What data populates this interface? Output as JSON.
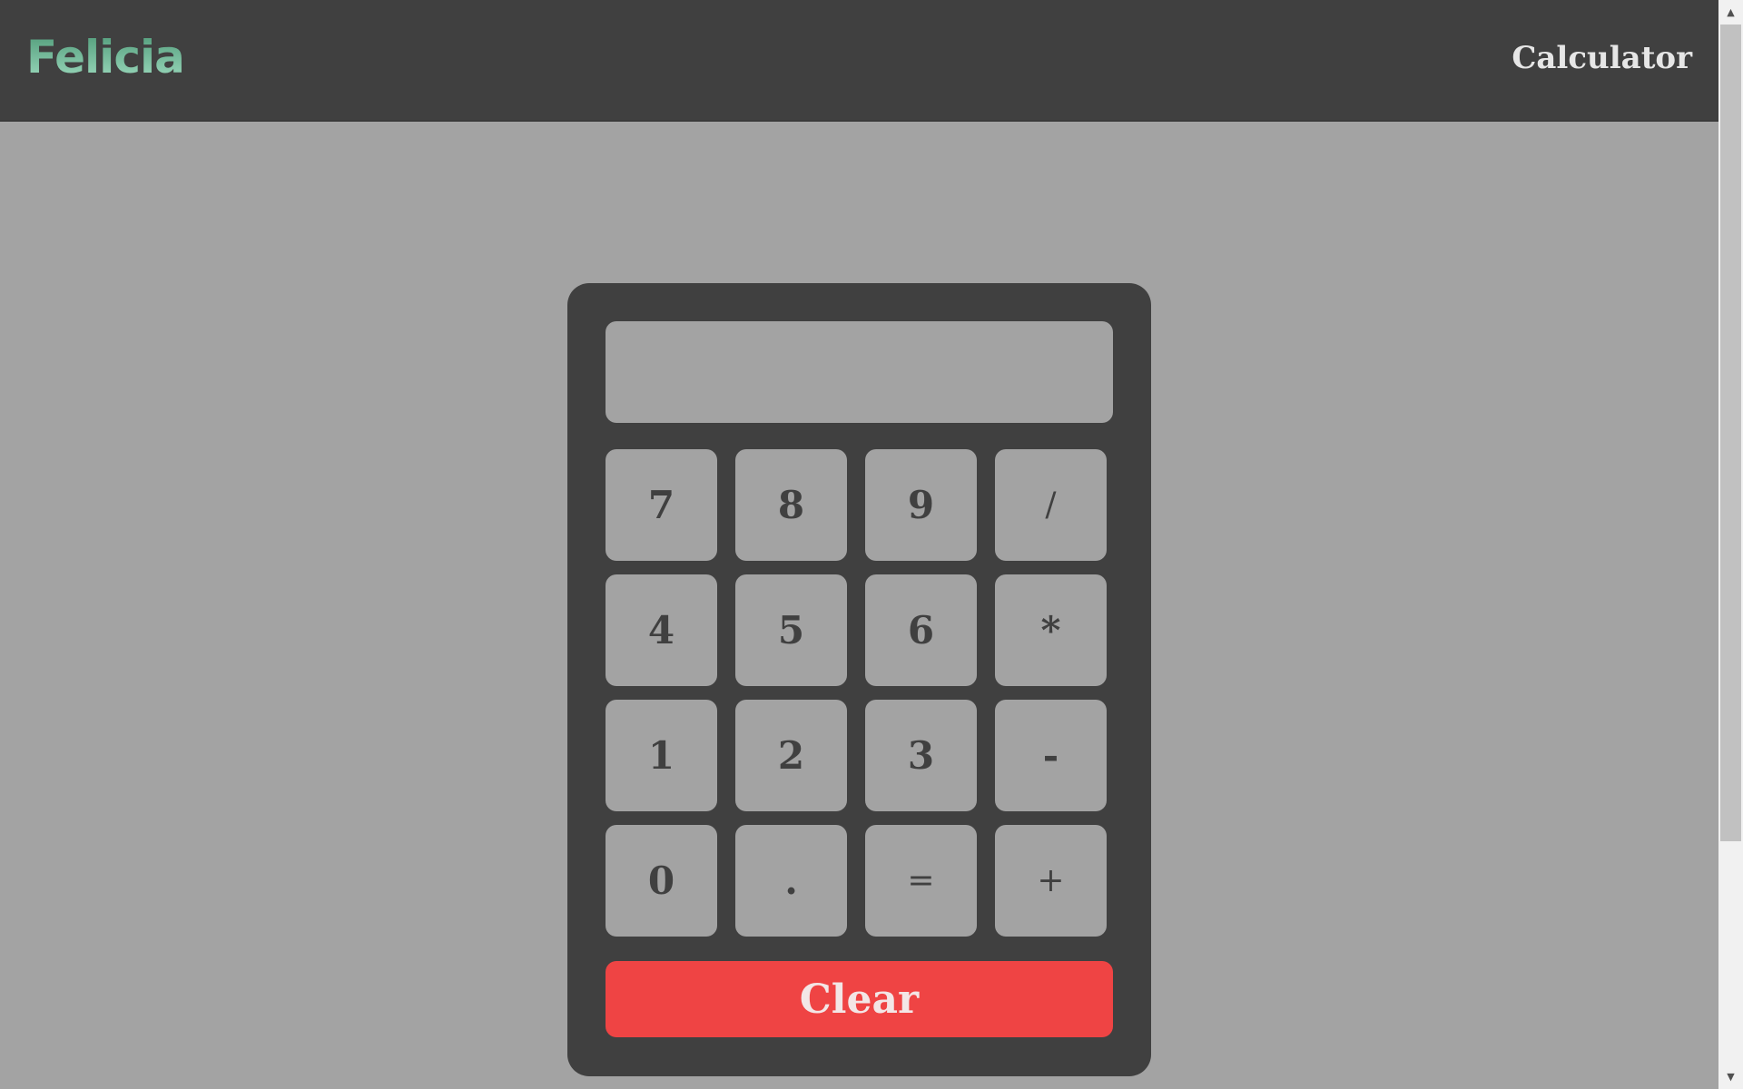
{
  "header": {
    "brand": "Felicia",
    "nav_link": "Calculator"
  },
  "calculator": {
    "display_value": "",
    "keys": [
      {
        "label": "7",
        "name": "key-7",
        "style": "bold"
      },
      {
        "label": "8",
        "name": "key-8",
        "style": "bold"
      },
      {
        "label": "9",
        "name": "key-9",
        "style": "bold"
      },
      {
        "label": "/",
        "name": "key-divide",
        "style": "light"
      },
      {
        "label": "4",
        "name": "key-4",
        "style": "bold"
      },
      {
        "label": "5",
        "name": "key-5",
        "style": "bold"
      },
      {
        "label": "6",
        "name": "key-6",
        "style": "bold"
      },
      {
        "label": "*",
        "name": "key-multiply",
        "style": "bold"
      },
      {
        "label": "1",
        "name": "key-1",
        "style": "bold"
      },
      {
        "label": "2",
        "name": "key-2",
        "style": "bold"
      },
      {
        "label": "3",
        "name": "key-3",
        "style": "bold"
      },
      {
        "label": "-",
        "name": "key-subtract",
        "style": "bold"
      },
      {
        "label": "0",
        "name": "key-0",
        "style": "bold"
      },
      {
        "label": ".",
        "name": "key-decimal",
        "style": "bold"
      },
      {
        "label": "=",
        "name": "key-equals",
        "style": "light"
      },
      {
        "label": "+",
        "name": "key-add",
        "style": "light"
      }
    ],
    "clear_label": "Clear"
  },
  "scrollbar": {
    "up_icon": "▲",
    "down_icon": "▼"
  },
  "colors": {
    "page_bg": "#a3a3a3",
    "header_bg": "#404040",
    "calc_bg": "#404040",
    "key_bg": "#a3a3a3",
    "clear_bg": "#ef4444",
    "brand_gradient_start": "#4f9a78",
    "brand_gradient_end": "#9fdcc0"
  }
}
